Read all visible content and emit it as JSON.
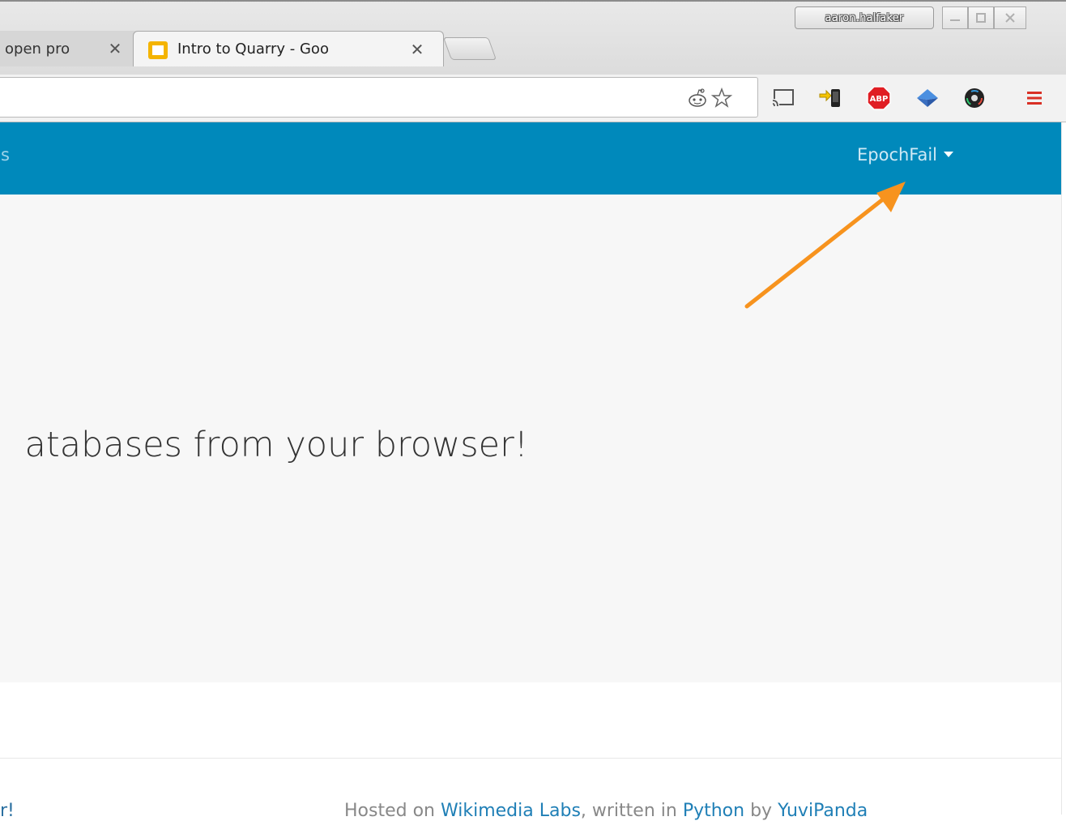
{
  "browser": {
    "profile_name": "aaron.halfaker",
    "tabs": [
      {
        "title": "open pro",
        "active": false
      },
      {
        "title": "Intro to Quarry - Goo",
        "active": true
      }
    ],
    "favicon_color": "#f4b400"
  },
  "toolbar": {
    "icons": [
      "reddit-icon",
      "bookmark-star-icon",
      "cast-icon",
      "phone-arrow-icon",
      "adblock-icon",
      "blue-diamond-icon",
      "color-wheel-icon",
      "menu-icon"
    ],
    "adblock_label": "ABP"
  },
  "navbar": {
    "partial_link": "s",
    "user_name": "EpochFail",
    "bg_color": "#0089bb"
  },
  "hero": {
    "text": "atabases from your browser!"
  },
  "footer": {
    "left_partial": "r!",
    "hosted_on": "Hosted on ",
    "link1": "Wikimedia Labs",
    "mid": ", written in ",
    "link2": "Python",
    "by": " by ",
    "link3": "YuviPanda"
  },
  "annotation": {
    "arrow_color": "#f7931e"
  }
}
